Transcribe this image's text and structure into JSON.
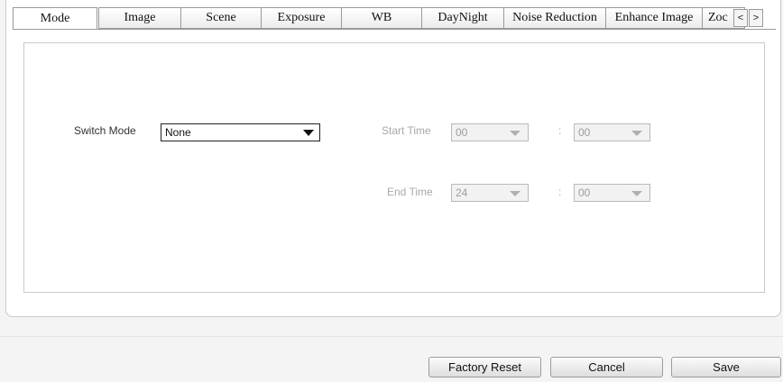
{
  "tabs": [
    {
      "label": "Mode",
      "active": true
    },
    {
      "label": "Image",
      "active": false
    },
    {
      "label": "Scene",
      "active": false
    },
    {
      "label": "Exposure",
      "active": false
    },
    {
      "label": "WB",
      "active": false
    },
    {
      "label": "DayNight",
      "active": false
    },
    {
      "label": "Noise Reduction",
      "active": false
    },
    {
      "label": "Enhance Image",
      "active": false
    },
    {
      "label": "Zoc",
      "active": false
    }
  ],
  "tab_nav": {
    "prev": "<",
    "next": ">"
  },
  "form": {
    "switch_mode": {
      "label": "Switch Mode",
      "value": "None"
    },
    "start_time": {
      "label": "Start Time",
      "hour": "00",
      "separator": ":",
      "minute": "00"
    },
    "end_time": {
      "label": "End Time",
      "hour": "24",
      "separator": ":",
      "minute": "00"
    }
  },
  "buttons": {
    "factory_reset": "Factory Reset",
    "cancel": "Cancel",
    "save": "Save"
  }
}
